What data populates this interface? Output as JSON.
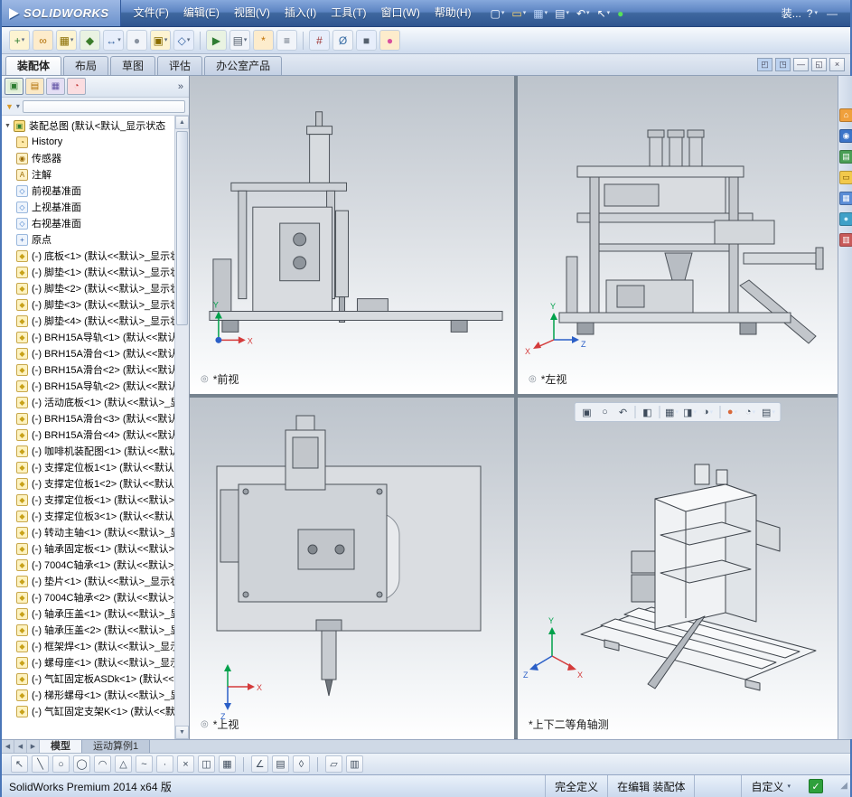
{
  "ui": {
    "caret": "▾",
    "overflow": "»",
    "expander": "▼",
    "filter_funnel": "▼",
    "scroll_up": "▲",
    "scroll_down": "▼",
    "view_badge": "◎",
    "grip": "◢"
  },
  "titlebar": {
    "logo": "SOLIDWORKS",
    "menus": [
      "文件(F)",
      "编辑(E)",
      "视图(V)",
      "插入(I)",
      "工具(T)",
      "窗口(W)",
      "帮助(H)"
    ],
    "doc_short": "装...",
    "help": "?",
    "minimize": "—",
    "quick_buttons": [
      {
        "name": "new-document",
        "glyph": "▢",
        "fg": "#f4f8ff",
        "caret": true
      },
      {
        "name": "open-document",
        "glyph": "▭",
        "fg": "#ffd76e",
        "caret": true
      },
      {
        "name": "save",
        "glyph": "▦",
        "fg": "#bcd4f8",
        "caret": true
      },
      {
        "name": "print",
        "glyph": "▤",
        "fg": "#e8eefc",
        "caret": true
      },
      {
        "name": "undo",
        "glyph": "↶",
        "fg": "#ffffff",
        "caret": true
      },
      {
        "name": "select-cursor",
        "glyph": "↖",
        "fg": "#ffffff",
        "caret": true
      },
      {
        "name": "rebuild",
        "glyph": "●",
        "fg": "#57e05a",
        "caret": false
      }
    ]
  },
  "main_toolbar": {
    "buttons": [
      {
        "name": "insert-component",
        "glyph": "+",
        "bg": "#fdf4d2",
        "fg": "#2e7d32",
        "caret": true
      },
      {
        "name": "mate",
        "glyph": "∞",
        "bg": "#fdeccc",
        "fg": "#b06c00"
      },
      {
        "name": "linear-component-pattern",
        "glyph": "▦",
        "bg": "#fdf4d2",
        "fg": "#8a6d00",
        "caret": true
      },
      {
        "name": "smart-fasteners",
        "glyph": "◆",
        "bg": "#e9f3e2",
        "fg": "#3a7d2a"
      },
      {
        "name": "move-component",
        "glyph": "↔",
        "bg": "#e7eefb",
        "fg": "#2f5e9e",
        "caret": true
      },
      {
        "name": "show-hidden-components",
        "glyph": "●",
        "bg": "#f1f4f9",
        "fg": "#8a93a0"
      },
      {
        "name": "assembly-features",
        "glyph": "▣",
        "bg": "#fdf4d2",
        "fg": "#8a6d00",
        "caret": true
      },
      {
        "name": "reference-geometry",
        "glyph": "◇",
        "bg": "#e7eefb",
        "fg": "#2f5e9e",
        "caret": true
      },
      {
        "sep": true
      },
      {
        "name": "new-motion-study",
        "glyph": "▶",
        "bg": "#e9f3e2",
        "fg": "#2e7d32"
      },
      {
        "name": "bill-of-materials",
        "glyph": "▤",
        "bg": "#f1f4f9",
        "fg": "#55606e",
        "caret": true
      },
      {
        "name": "exploded-view",
        "glyph": "*",
        "bg": "#fdeccc",
        "fg": "#c07000"
      },
      {
        "name": "explode-line-sketch",
        "glyph": "≡",
        "bg": "#f1f4f9",
        "fg": "#55606e"
      },
      {
        "sep": true
      },
      {
        "name": "interference-detection",
        "glyph": "#",
        "bg": "#e7eefb",
        "fg": "#9e3535"
      },
      {
        "name": "measure",
        "glyph": "Ø",
        "bg": "#f1f4f9",
        "fg": "#3a6ea5"
      },
      {
        "name": "section-view",
        "glyph": "■",
        "bg": "#e7eefb",
        "fg": "#55606e"
      },
      {
        "name": "appearance",
        "glyph": "●",
        "bg": "#fdeccc",
        "fg": "#d84f9e"
      }
    ]
  },
  "command_tabs": {
    "tabs": [
      {
        "id": "assembly",
        "label": "装配体",
        "active": true
      },
      {
        "id": "layout",
        "label": "布局",
        "active": false
      },
      {
        "id": "sketch",
        "label": "草图",
        "active": false
      },
      {
        "id": "evaluate",
        "label": "评估",
        "active": false
      },
      {
        "id": "office-products",
        "label": "办公室产品",
        "active": false
      }
    ]
  },
  "window_controls": {
    "buttons": [
      {
        "name": "split-view-left",
        "glyph": "◰",
        "bg": "#bcd2f0"
      },
      {
        "name": "split-view-right",
        "glyph": "◳",
        "bg": "#bcd2f0"
      },
      {
        "name": "minimize-document",
        "glyph": "—"
      },
      {
        "name": "restore-document",
        "glyph": "◱"
      },
      {
        "name": "close-document",
        "glyph": "×"
      }
    ]
  },
  "panel": {
    "tabs": [
      {
        "name": "feature-manager-tab",
        "glyph": "▣",
        "bg": "#e2efd8",
        "fg": "#2e7d32",
        "active": true
      },
      {
        "name": "property-manager-tab",
        "glyph": "▤",
        "bg": "#fbe9c6",
        "fg": "#b06c00",
        "active": false
      },
      {
        "name": "configuration-manager-tab",
        "glyph": "▦",
        "bg": "#e4def4",
        "fg": "#5e4fa2",
        "active": false
      },
      {
        "name": "display-manager-tab",
        "glyph": "◔",
        "bg": "#fbdde0",
        "fg": "#c23b3b",
        "active": false
      }
    ],
    "tree": {
      "root": {
        "type": "assembly",
        "label": "装配总图 (默认<默认_显示状态"
      },
      "items": [
        {
          "type": "history",
          "label": "History"
        },
        {
          "type": "sensors",
          "label": "传感器"
        },
        {
          "type": "annotations",
          "label": "注解"
        },
        {
          "type": "plane",
          "label": "前视基准面"
        },
        {
          "type": "plane",
          "label": "上视基准面"
        },
        {
          "type": "plane",
          "label": "右视基准面"
        },
        {
          "type": "origin",
          "label": "原点"
        },
        {
          "type": "part",
          "label": "(-) 底板<1> (默认<<默认>_显示状态"
        },
        {
          "type": "part",
          "label": "(-) 脚垫<1> (默认<<默认>_显示状态"
        },
        {
          "type": "part",
          "label": "(-) 脚垫<2> (默认<<默认>_显示状态"
        },
        {
          "type": "part",
          "label": "(-) 脚垫<3> (默认<<默认>_显示状态"
        },
        {
          "type": "part",
          "label": "(-) 脚垫<4> (默认<<默认>_显示状态"
        },
        {
          "type": "part",
          "label": "(-) BRH15A导轨<1> (默认<<默认"
        },
        {
          "type": "part",
          "label": "(-) BRH15A滑台<1> (默认<<默认"
        },
        {
          "type": "part",
          "label": "(-) BRH15A滑台<2> (默认<<默认"
        },
        {
          "type": "part",
          "label": "(-) BRH15A导轨<2> (默认<<默认"
        },
        {
          "type": "part",
          "label": "(-) 活动底板<1> (默认<<默认>_显"
        },
        {
          "type": "part",
          "label": "(-) BRH15A滑台<3> (默认<<默认"
        },
        {
          "type": "part",
          "label": "(-) BRH15A滑台<4> (默认<<默认"
        },
        {
          "type": "part",
          "label": "(-) 咖啡机装配图<1> (默认<<默认"
        },
        {
          "type": "part",
          "label": "(-) 支撑定位板1<1> (默认<<默认"
        },
        {
          "type": "part",
          "label": "(-) 支撑定位板1<2> (默认<<默认"
        },
        {
          "type": "part",
          "label": "(-) 支撑定位板<1> (默认<<默认>"
        },
        {
          "type": "part",
          "label": "(-) 支撑定位板3<1> (默认<<默认"
        },
        {
          "type": "part",
          "label": "(-) 转动主轴<1> (默认<<默认>_显"
        },
        {
          "type": "part",
          "label": "(-) 轴承固定板<1> (默认<<默认>"
        },
        {
          "type": "part",
          "label": "(-) 7004C轴承<1> (默认<<默认>_"
        },
        {
          "type": "part",
          "label": "(-) 垫片<1> (默认<<默认>_显示状"
        },
        {
          "type": "part",
          "label": "(-) 7004C轴承<2> (默认<<默认>_"
        },
        {
          "type": "part",
          "label": "(-) 轴承压盖<1> (默认<<默认>_显"
        },
        {
          "type": "part",
          "label": "(-) 轴承压盖<2> (默认<<默认>_显"
        },
        {
          "type": "part",
          "label": "(-) 框架焊<1> (默认<<默认>_显示"
        },
        {
          "type": "part",
          "label": "(-) 螺母座<1> (默认<<默认>_显示"
        },
        {
          "type": "part",
          "label": "(-) 气缸固定板ASDk<1> (默认<<"
        },
        {
          "type": "part",
          "label": "(-) 梯形螺母<1> (默认<<默认>_显"
        },
        {
          "type": "part",
          "label": "(-) 气缸固定支架K<1> (默认<<默"
        }
      ]
    }
  },
  "icon_styles": {
    "assembly": {
      "glyph": "▣",
      "fg": "#2e7d32",
      "bg": "#ffe082",
      "bd": "#a98e2e"
    },
    "history": {
      "glyph": "◔",
      "fg": "#7a5c00",
      "bg": "#ffe9a8",
      "bd": "#c0a050"
    },
    "sensors": {
      "glyph": "◉",
      "fg": "#9a6a00",
      "bg": "#fff2c8",
      "bd": "#c0a050"
    },
    "annotations": {
      "glyph": "A",
      "fg": "#9a6a00",
      "bg": "#fff2c8",
      "bd": "#c0a050"
    },
    "plane": {
      "glyph": "◇",
      "fg": "#3a78c8",
      "bg": "#eef4fc",
      "bd": "#9ab8dd"
    },
    "origin": {
      "glyph": "+",
      "fg": "#2a5fb0",
      "bg": "#eef4fc",
      "bd": "#9ab8dd"
    },
    "part": {
      "glyph": "◆",
      "fg": "#c8a21a",
      "bg": "#fdf2c0",
      "bd": "#c8a84b"
    }
  },
  "viewports": {
    "front": {
      "label": "*前视"
    },
    "left": {
      "label": "*左视"
    },
    "top": {
      "label": "*上视"
    },
    "iso": {
      "label": "*上下二等角轴测"
    },
    "axis": {
      "x": "X",
      "y": "Y",
      "z": "Z"
    }
  },
  "headsup": {
    "buttons": [
      {
        "name": "zoom-to-fit",
        "glyph": "▣"
      },
      {
        "name": "zoom-to-area",
        "glyph": "○"
      },
      {
        "name": "previous-view",
        "glyph": "↶"
      },
      {
        "sep": true
      },
      {
        "name": "section-view",
        "glyph": "◧"
      },
      {
        "sep": true
      },
      {
        "name": "view-orientation",
        "glyph": "▦",
        "caret": true
      },
      {
        "name": "display-style",
        "glyph": "◨",
        "caret": true
      },
      {
        "name": "hide-show-items",
        "glyph": "◑",
        "caret": true
      },
      {
        "sep": true
      },
      {
        "name": "edit-appearance",
        "glyph": "●",
        "fg": "#d8683a",
        "caret": true
      },
      {
        "name": "apply-scene",
        "glyph": "◔",
        "caret": true
      },
      {
        "name": "view-settings",
        "glyph": "▤",
        "caret": true
      }
    ]
  },
  "task_pane": {
    "icons": [
      {
        "name": "solidworks-resources",
        "glyph": "⌂",
        "bg": "#f0a03c",
        "fg": "#ffffff"
      },
      {
        "name": "solidworks-forum",
        "glyph": "◉",
        "bg": "#3b74c8",
        "fg": "#ffffff"
      },
      {
        "name": "design-library",
        "glyph": "▤",
        "bg": "#4a9e55",
        "fg": "#ffffff"
      },
      {
        "name": "file-explorer",
        "glyph": "▭",
        "bg": "#f2c94c",
        "fg": "#7a5500"
      },
      {
        "name": "view-palette",
        "glyph": "▦",
        "bg": "#5b8dd6",
        "fg": "#ffffff"
      },
      {
        "name": "appearances-scenes",
        "glyph": "●",
        "bg": "#3fa0c8",
        "fg": "#d4f0fa"
      },
      {
        "name": "custom-properties",
        "glyph": "▥",
        "bg": "#c85a5a",
        "fg": "#ffffff"
      }
    ]
  },
  "document_tabs": {
    "nav": [
      {
        "name": "nav-start",
        "glyph": "◀"
      },
      {
        "name": "nav-prev",
        "glyph": "◀"
      },
      {
        "name": "nav-next",
        "glyph": "▶"
      }
    ],
    "tabs": [
      {
        "id": "model",
        "label": "模型",
        "active": true
      },
      {
        "id": "motion-study-1",
        "label": "运动算例1",
        "active": false
      }
    ]
  },
  "sketch_toolbar": {
    "buttons": [
      {
        "name": "sketch-select",
        "glyph": "↖"
      },
      {
        "name": "sketch-line",
        "glyph": "╲"
      },
      {
        "name": "sketch-circle",
        "glyph": "○"
      },
      {
        "name": "sketch-ellipse",
        "glyph": "◯"
      },
      {
        "name": "sketch-arc",
        "glyph": "◠"
      },
      {
        "name": "sketch-polygon",
        "glyph": "△"
      },
      {
        "name": "sketch-spline",
        "glyph": "~"
      },
      {
        "name": "sketch-point",
        "glyph": "·"
      },
      {
        "name": "sketch-trim",
        "glyph": "×"
      },
      {
        "name": "sketch-mirror",
        "glyph": "◫"
      },
      {
        "name": "sketch-pattern",
        "glyph": "▦"
      },
      {
        "sep": true
      },
      {
        "name": "sketch-relations",
        "glyph": "∠"
      },
      {
        "name": "sketch-grid",
        "glyph": "▤"
      },
      {
        "name": "sketch-dimension",
        "glyph": "◊"
      },
      {
        "sep": true
      },
      {
        "name": "sketch-plane",
        "glyph": "▱"
      },
      {
        "name": "sketch-table",
        "glyph": "▥"
      }
    ]
  },
  "status_bar": {
    "left": "SolidWorks Premium 2014 x64 版",
    "defined": "完全定义",
    "editing": "在编辑 装配体",
    "custom": "自定义",
    "check": "✓"
  }
}
